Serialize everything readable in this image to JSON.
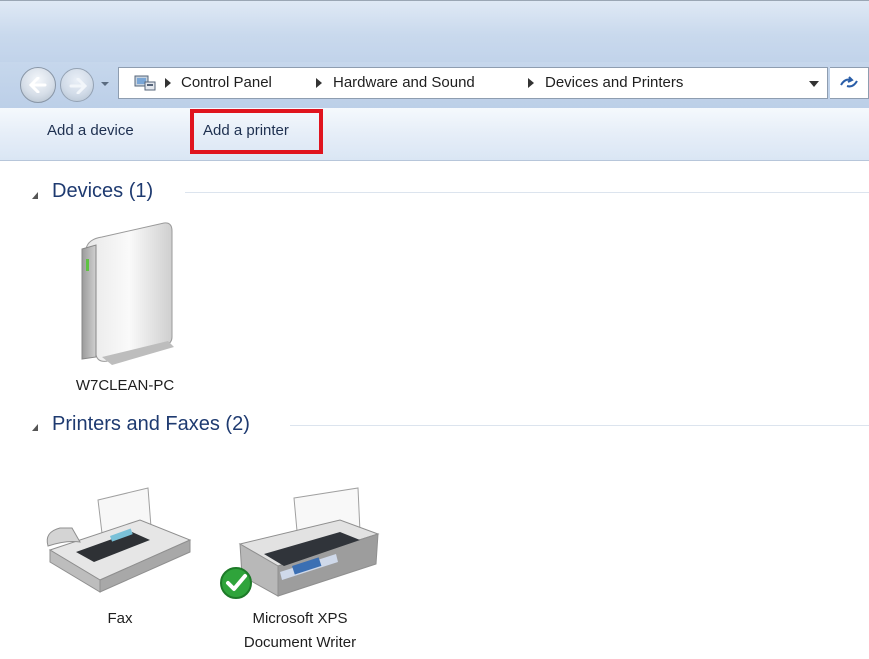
{
  "address_bar": {
    "crumbs": [
      "Control Panel",
      "Hardware and Sound",
      "Devices and Printers"
    ],
    "icons": {
      "back": "back-arrow-icon",
      "forward": "forward-arrow-icon",
      "recent": "recent-pages-icon",
      "location": "devices-folder-icon",
      "dropdown": "chevron-down-icon",
      "refresh": "refresh-icon"
    }
  },
  "toolbar": {
    "add_device": "Add a device",
    "add_printer": "Add a printer",
    "highlight_color": "#e0141e"
  },
  "groups": {
    "devices": {
      "header": "Devices (1)",
      "items": [
        {
          "label": "W7CLEAN-PC",
          "icon": "computer-tower-icon"
        }
      ]
    },
    "printers": {
      "header": "Printers and Faxes (2)",
      "items": [
        {
          "label": "Fax",
          "icon": "fax-machine-icon"
        },
        {
          "label_line1": "Microsoft XPS",
          "label_line2": "Document Writer",
          "icon": "printer-icon",
          "badge": "default-checkmark-icon"
        }
      ]
    }
  },
  "colors": {
    "group_header": "#1e3a70",
    "toolbar_text": "#1e3050",
    "default_badge": "#2fa43b"
  }
}
